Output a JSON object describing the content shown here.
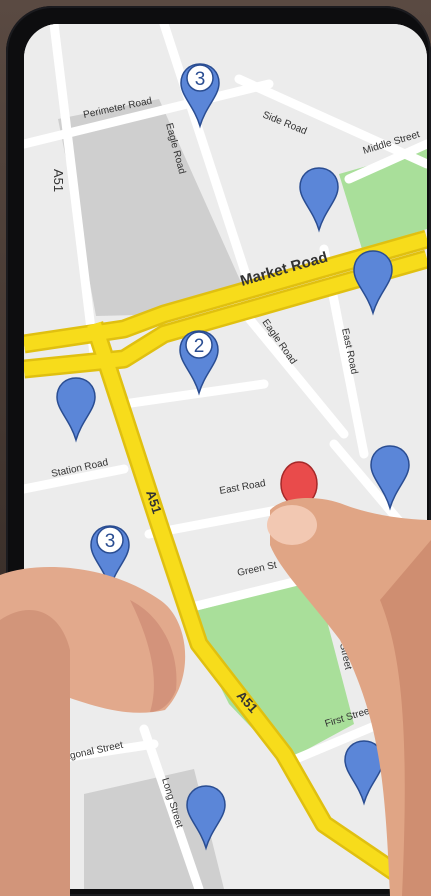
{
  "map": {
    "roads": {
      "perimeter_road": "Perimeter Road",
      "eagle_road_top": "Eagle Road",
      "side_road": "Side Road",
      "middle_street": "Middle Street",
      "a51_left": "A51",
      "market_road": "Market Road",
      "eagle_road_mid": "Eagle Road",
      "east_road_vertical": "East Road",
      "station_road": "Station Road",
      "east_road": "East Road",
      "a51_mid": "A51",
      "green_street": "Green St",
      "street_right": "Street",
      "a51_bottom": "A51",
      "first_street": "First Street",
      "diagonal_street": "Diagonal Street",
      "long_street": "Long Street"
    },
    "markers": {
      "cluster_top": "3",
      "cluster_mid": "2",
      "cluster_left": "3"
    },
    "colors": {
      "major_road": "#f7dc1b",
      "marker_blue": "#5b86d8",
      "marker_selected": "#e94b4b",
      "park": "#a9df9a",
      "block": "#cfcfcf",
      "background": "#ececec"
    },
    "icons": [
      "map-pin-icon",
      "cluster-pin-icon",
      "selected-pin-icon"
    ]
  }
}
